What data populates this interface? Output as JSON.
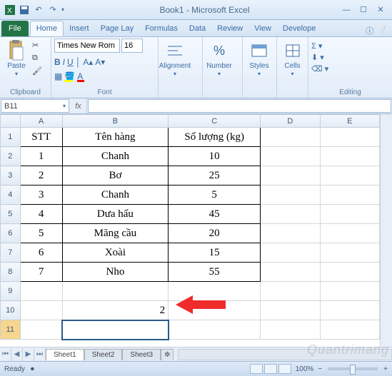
{
  "title": "Book1 - Microsoft Excel",
  "qat": {
    "save": "💾"
  },
  "tabs": {
    "file": "File",
    "home": "Home",
    "insert": "Insert",
    "page": "Page Lay",
    "formulas": "Formulas",
    "data": "Data",
    "review": "Review",
    "view": "View",
    "developer": "Develope"
  },
  "ribbon": {
    "clipboard": {
      "label": "Clipboard",
      "paste": "Paste"
    },
    "font": {
      "label": "Font",
      "name": "Times New Rom",
      "size": "16",
      "bold": "B",
      "italic": "I",
      "underline": "U"
    },
    "alignment": {
      "label": "Alignment"
    },
    "number": {
      "label": "Number"
    },
    "styles": {
      "label": "Styles"
    },
    "cells": {
      "label": "Cells"
    },
    "editing": {
      "label": "Editing"
    }
  },
  "namebox": "B11",
  "fx": "fx",
  "columns": [
    "A",
    "B",
    "C",
    "D",
    "E"
  ],
  "rows": [
    "1",
    "2",
    "3",
    "4",
    "5",
    "6",
    "7",
    "8",
    "9",
    "10",
    "11"
  ],
  "table": {
    "headers": {
      "a": "STT",
      "b": "Tên hàng",
      "c": "Số lượng (kg)"
    },
    "rows": [
      {
        "a": "1",
        "b": "Chanh",
        "c": "10"
      },
      {
        "a": "2",
        "b": "Bơ",
        "c": "25"
      },
      {
        "a": "3",
        "b": "Chanh",
        "c": "5"
      },
      {
        "a": "4",
        "b": "Dưa hấu",
        "c": "45"
      },
      {
        "a": "5",
        "b": "Măng cầu",
        "c": "20"
      },
      {
        "a": "6",
        "b": "Xoài",
        "c": "15"
      },
      {
        "a": "7",
        "b": "Nho",
        "c": "55"
      }
    ],
    "b10": "2"
  },
  "sheets": {
    "s1": "Sheet1",
    "s2": "Sheet2",
    "s3": "Sheet3"
  },
  "status": {
    "ready": "Ready",
    "zoom": "100%"
  },
  "watermark": "Quantrimang"
}
